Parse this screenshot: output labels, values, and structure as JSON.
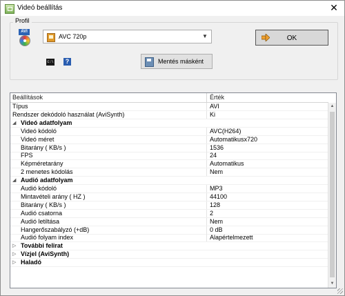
{
  "window": {
    "title": "Videó beállítás"
  },
  "profile": {
    "group_label": "Profil",
    "selected": "AVC 720p",
    "save_as_label": "Mentés másként",
    "ok_label": "OK",
    "cmd_icon_text": "C:\\"
  },
  "grid": {
    "col_settings": "Beállítások",
    "col_value": "Érték",
    "rows": [
      {
        "name": "Típus",
        "value": "AVI",
        "level": 0,
        "category": false
      },
      {
        "name": "Rendszer dekódoló használat (AviSynth)",
        "value": "Ki",
        "level": 0,
        "category": false
      },
      {
        "name": "Videó adatfolyam",
        "value": "",
        "level": 0,
        "category": true,
        "expanded": true
      },
      {
        "name": "Videó kódoló",
        "value": "AVC(H264)",
        "level": 1,
        "category": false
      },
      {
        "name": "Videó méret",
        "value": "Automatikusx720",
        "level": 1,
        "category": false
      },
      {
        "name": "Bitarány ( KB/s )",
        "value": "1536",
        "level": 1,
        "category": false
      },
      {
        "name": "FPS",
        "value": "24",
        "level": 1,
        "category": false
      },
      {
        "name": "Képméretarány",
        "value": "Automatikus",
        "level": 1,
        "category": false
      },
      {
        "name": "2 menetes kódolás",
        "value": "Nem",
        "level": 1,
        "category": false
      },
      {
        "name": "Audió adatfolyam",
        "value": "",
        "level": 0,
        "category": true,
        "expanded": true
      },
      {
        "name": "Audió kódoló",
        "value": "MP3",
        "level": 1,
        "category": false
      },
      {
        "name": "Mintavételi arány ( HZ )",
        "value": "44100",
        "level": 1,
        "category": false
      },
      {
        "name": "Bitarány ( KB/s )",
        "value": "128",
        "level": 1,
        "category": false
      },
      {
        "name": "Audió csatorna",
        "value": "2",
        "level": 1,
        "category": false
      },
      {
        "name": "Audió letiltása",
        "value": "Nem",
        "level": 1,
        "category": false
      },
      {
        "name": "Hangerőszabályzó (+dB)",
        "value": "0 dB",
        "level": 1,
        "category": false
      },
      {
        "name": "Audió folyam index",
        "value": "Alapértelmezett",
        "level": 1,
        "category": false
      },
      {
        "name": "További felirat",
        "value": "",
        "level": 0,
        "category": true,
        "expanded": false
      },
      {
        "name": "Vízjel (AviSynth)",
        "value": "",
        "level": 0,
        "category": true,
        "expanded": false
      },
      {
        "name": "Haladó",
        "value": "",
        "level": 0,
        "category": true,
        "expanded": false
      }
    ]
  },
  "icons": {
    "app": "settings-app-icon",
    "avi": "avi-file-icon",
    "film": "film-icon",
    "ok_arrow": "arrow-right-icon",
    "cmd": "command-prompt-icon",
    "help": "help-icon",
    "save": "floppy-disk-icon"
  }
}
